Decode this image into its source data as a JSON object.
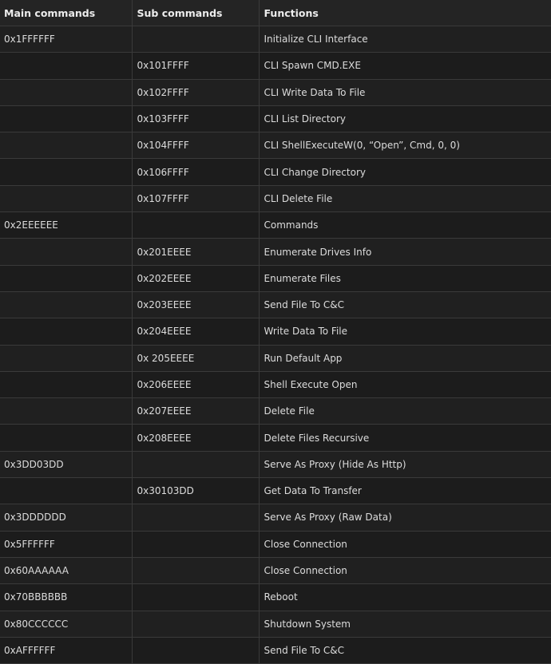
{
  "table": {
    "headers": [
      "Main commands",
      "Sub commands",
      "Functions"
    ],
    "rows": [
      {
        "main": "0x1FFFFFF",
        "sub": "",
        "func": "Initialize CLI Interface"
      },
      {
        "main": "",
        "sub": "0x101FFFF",
        "func": "CLI Spawn CMD.EXE"
      },
      {
        "main": "",
        "sub": "0x102FFFF",
        "func": "CLI Write Data To File"
      },
      {
        "main": "",
        "sub": "0x103FFFF",
        "func": "CLI List Directory"
      },
      {
        "main": "",
        "sub": "0x104FFFF",
        "func": "CLI ShellExecuteW(0, “Open”, Cmd, 0, 0)"
      },
      {
        "main": "",
        "sub": "0x106FFFF",
        "func": "CLI Change Directory"
      },
      {
        "main": "",
        "sub": "0x107FFFF",
        "func": "CLI Delete File"
      },
      {
        "main": "0x2EEEEEE",
        "sub": "",
        "func": "Commands"
      },
      {
        "main": "",
        "sub": "0x201EEEE",
        "func": "Enumerate Drives Info"
      },
      {
        "main": "",
        "sub": "0x202EEEE",
        "func": "Enumerate Files"
      },
      {
        "main": "",
        "sub": "0x203EEEE",
        "func": "Send File To C&C"
      },
      {
        "main": "",
        "sub": "0x204EEEE",
        "func": "Write Data To File"
      },
      {
        "main": "",
        "sub": "0x 205EEEE",
        "func": "Run Default App"
      },
      {
        "main": "",
        "sub": "0x206EEEE",
        "func": "Shell Execute Open"
      },
      {
        "main": "",
        "sub": "0x207EEEE",
        "func": "Delete File"
      },
      {
        "main": "",
        "sub": "0x208EEEE",
        "func": "Delete Files Recursive"
      },
      {
        "main": "0x3DD03DD",
        "sub": "",
        "func": "Serve As Proxy (Hide As Http)"
      },
      {
        "main": "",
        "sub": "0x30103DD",
        "func": "Get Data To Transfer"
      },
      {
        "main": "0x3DDDDDD",
        "sub": "",
        "func": "Serve As Proxy (Raw Data)"
      },
      {
        "main": "0x5FFFFFF",
        "sub": "",
        "func": "Close Connection"
      },
      {
        "main": "0x60AAAAAA",
        "sub": "",
        "func": "Close Connection"
      },
      {
        "main": "0x70BBBBBB",
        "sub": "",
        "func": "Reboot"
      },
      {
        "main": "0x80CCCCCC",
        "sub": "",
        "func": "Shutdown System"
      },
      {
        "main": "0xAFFFFFF",
        "sub": "",
        "func": "Send File To C&C"
      }
    ]
  }
}
